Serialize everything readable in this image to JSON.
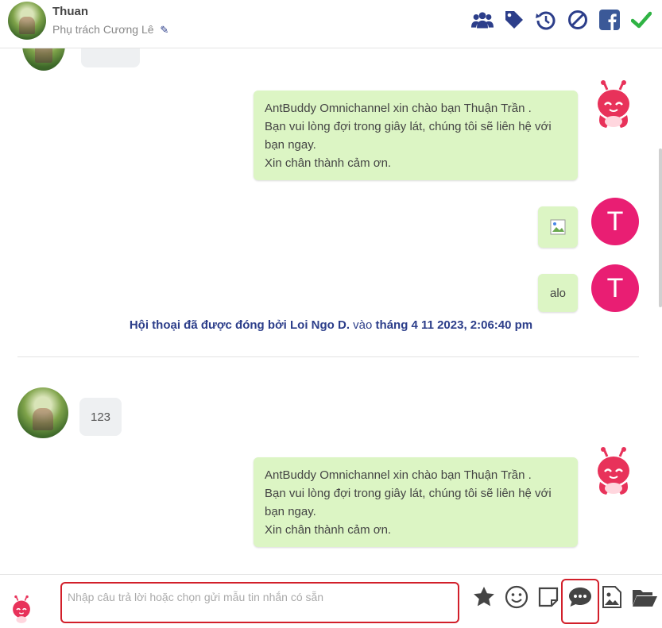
{
  "header": {
    "contact_name": "Thuan",
    "assignee": "Phụ trách Cương Lê",
    "icons": [
      "users-icon",
      "tag-icon",
      "history-icon",
      "block-icon",
      "facebook-icon",
      "check-icon"
    ],
    "colors": {
      "icon": "#2c3e8a",
      "facebook": "#3b5998",
      "check": "#2fb344"
    }
  },
  "messages": {
    "bot_welcome_1": {
      "line1": "AntBuddy Omnichannel xin chào bạn Thuận Trần .",
      "line2": "Bạn vui lòng đợi trong giây lát, chúng tôi sẽ liên hệ với",
      "line3": "bạn ngay.",
      "line4": "Xin chân thành cảm ơn."
    },
    "agent_avatar_letter": "T",
    "agent_text": "alo",
    "closed_note": {
      "prefix": "Hội thoại đã được đóng bởi Loi Ngo D.",
      "middle": " vào ",
      "datetime": "tháng 4 11 2023, 2:06:40 pm"
    },
    "customer_text": "123",
    "bot_welcome_2": {
      "line1": "AntBuddy Omnichannel xin chào bạn Thuận Trần .",
      "line2": "Bạn vui lòng đợi trong giây lát, chúng tôi sẽ liên hệ với",
      "line3": "bạn ngay.",
      "line4": "Xin chân thành cảm ơn."
    }
  },
  "composer": {
    "placeholder": "Nhập câu trả lời hoặc chọn gửi mẫu tin nhắn có sẵn",
    "tools": [
      "star-icon",
      "emoji-icon",
      "note-icon",
      "message-template-icon",
      "image-icon",
      "folder-icon"
    ]
  },
  "colors": {
    "bot_bubble": "#dcf5c4",
    "agent_avatar": "#e91e73",
    "highlight": "#d21f2a",
    "brand": "#2c3e8a"
  }
}
